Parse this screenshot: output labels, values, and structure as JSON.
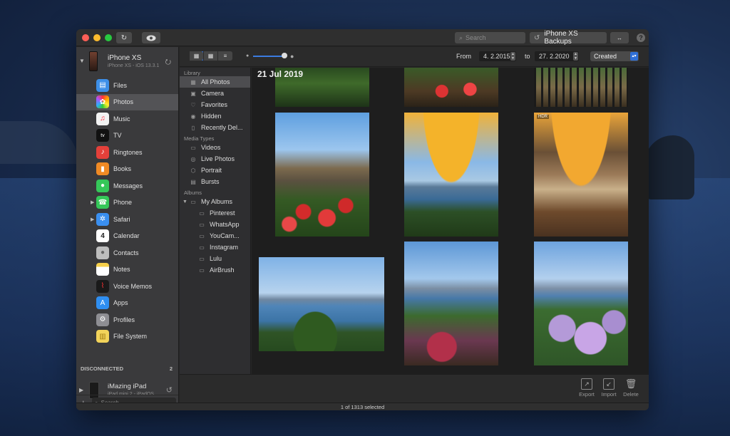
{
  "titlebar": {
    "refresh_icon": "refresh-icon",
    "preview_icon": "eye-icon",
    "search_placeholder": "Search",
    "backups_label": "iPhone XS Backups",
    "backups_icon": "history-icon",
    "transfer_icon": "arrows-icon",
    "help_label": "?"
  },
  "sidebar": {
    "device": {
      "name": "iPhone XS",
      "subtitle": "iPhone XS - iOS 13.3.1"
    },
    "items": [
      {
        "label": "Files",
        "icon": "folder-icon",
        "color": "#3d8fe8"
      },
      {
        "label": "Photos",
        "icon": "photos-icon",
        "color": "#ffffff"
      },
      {
        "label": "Music",
        "icon": "music-icon",
        "color": "#f2f2f2"
      },
      {
        "label": "TV",
        "icon": "tv-icon",
        "color": "#111111"
      },
      {
        "label": "Ringtones",
        "icon": "bell-icon",
        "color": "#e4403a"
      },
      {
        "label": "Books",
        "icon": "book-icon",
        "color": "#f08a24"
      },
      {
        "label": "Messages",
        "icon": "message-icon",
        "color": "#35c759"
      },
      {
        "label": "Phone",
        "icon": "phone-icon",
        "color": "#35c759"
      },
      {
        "label": "Safari",
        "icon": "compass-icon",
        "color": "#3a8ff0"
      },
      {
        "label": "Calendar",
        "icon": "calendar-icon",
        "color": "#ffffff"
      },
      {
        "label": "Contacts",
        "icon": "contacts-icon",
        "color": "#bdbdbd"
      },
      {
        "label": "Notes",
        "icon": "notes-icon",
        "color": "#f7d04a"
      },
      {
        "label": "Voice Memos",
        "icon": "waveform-icon",
        "color": "#1a1a1a"
      },
      {
        "label": "Apps",
        "icon": "appstore-icon",
        "color": "#2f8ef0"
      },
      {
        "label": "Profiles",
        "icon": "gear-icon",
        "color": "#8e8e93"
      },
      {
        "label": "File System",
        "icon": "file-icon",
        "color": "#f2d35a"
      }
    ],
    "calendar_day": "4",
    "disconnected_label": "DISCONNECTED",
    "disconnected_count": "2",
    "ipad": {
      "name": "iMazing iPad",
      "subtitle": "iPad mini 2 - iPadOS"
    },
    "add_label": "+",
    "search_placeholder": "Search"
  },
  "toolbar": {
    "from_label": "From",
    "from_date": "4. 2.2015",
    "to_label": "to",
    "to_date": "27. 2.2020",
    "sort_value": "Created"
  },
  "library": {
    "library_head": "Library",
    "library_items": [
      "All Photos",
      "Camera",
      "Favorites",
      "Hidden",
      "Recently Del..."
    ],
    "media_head": "Media Types",
    "media_items": [
      "Videos",
      "Live Photos",
      "Portrait",
      "Bursts"
    ],
    "albums_head": "Albums",
    "my_albums": "My Albums",
    "album_items": [
      "Pinterest",
      "WhatsApp",
      "YouCam...",
      "Instagram",
      "Lulu",
      "AirBrush"
    ]
  },
  "photos": {
    "date_header": "21 Jul 2019",
    "hdr_badge": "HDR"
  },
  "actions": {
    "export_label": "Export",
    "import_label": "Import",
    "delete_label": "Delete"
  },
  "status": {
    "text": "1 of 1313 selected"
  }
}
